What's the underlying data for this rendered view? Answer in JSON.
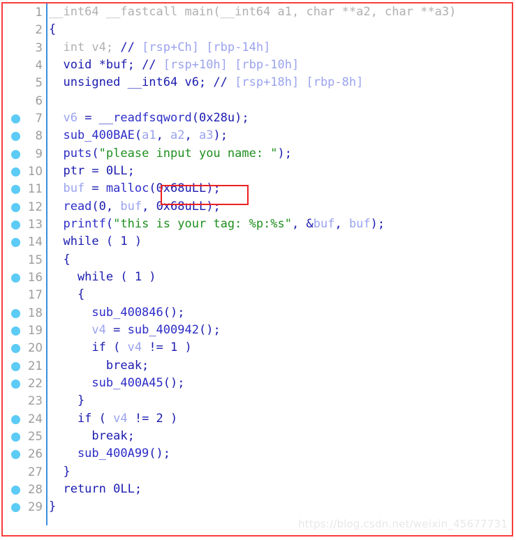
{
  "window": {
    "title": "Pseudocode-A",
    "border_color": "#fa3c3c",
    "background": "#ffffff"
  },
  "gutter": {
    "rule_color": "#3b8ede",
    "breakpoint_color": "#5ccbf5",
    "lineno_color": "#9c9c9c"
  },
  "annotation": {
    "name": "malloc-size-highlight",
    "color": "#ee2020",
    "covers_text": "(0x68uLL);"
  },
  "watermark": {
    "text": "https://blog.csdn.net/weixin_45677731",
    "color": "#e8e8e8"
  },
  "colors": {
    "dim": "#b0b0b0",
    "keyword": "#1b1bb0",
    "function": "#2d2dc8",
    "variable": "#9aa3ee",
    "string": "#1f8f1f",
    "comment": "#9aa3ee"
  },
  "code": {
    "language": "c-pseudocode",
    "plain_text": "__int64 __fastcall main(__int64 a1, char **a2, char **a3)\n{\n  int v4; // [rsp+Ch] [rbp-14h]\n  void *buf; // [rsp+10h] [rbp-10h]\n  unsigned __int64 v6; // [rsp+18h] [rbp-8h]\n\n  v6 = __readfsqword(0x28u);\n  sub_400BAE(a1, a2, a3);\n  puts(\"please input you name: \");\n  ptr = 0LL;\n  buf = malloc(0x68uLL);\n  read(0, buf, 0x68uLL);\n  printf(\"this is your tag: %p:%s\", &buf, buf);\n  while ( 1 )\n  {\n    while ( 1 )\n    {\n      sub_400846();\n      v4 = sub_400942();\n      if ( v4 != 1 )\n        break;\n      sub_400A45();\n    }\n    if ( v4 != 2 )\n      break;\n    sub_400A99();\n  }\n  return 0LL;\n}",
    "lines": [
      {
        "n": "1",
        "bp": false,
        "tokens": [
          {
            "c": "dim",
            "t": "__int64 __fastcall main(__int64 a1, char **a2, char **a3)"
          }
        ]
      },
      {
        "n": "2",
        "bp": false,
        "tokens": [
          {
            "c": "kw",
            "t": "{"
          }
        ]
      },
      {
        "n": "3",
        "bp": false,
        "tokens": [
          {
            "c": "dim",
            "t": "  int v4; "
          },
          {
            "c": "cmtmark",
            "t": "// "
          },
          {
            "c": "cmt",
            "t": "[rsp+Ch] [rbp-14h]"
          }
        ]
      },
      {
        "n": "4",
        "bp": false,
        "tokens": [
          {
            "c": "kw",
            "t": "  void *buf; "
          },
          {
            "c": "cmtmark",
            "t": "// "
          },
          {
            "c": "cmt",
            "t": "[rsp+10h] [rbp-10h]"
          }
        ]
      },
      {
        "n": "5",
        "bp": false,
        "tokens": [
          {
            "c": "kw",
            "t": "  unsigned __int64 v6; "
          },
          {
            "c": "cmtmark",
            "t": "// "
          },
          {
            "c": "cmt",
            "t": "[rsp+18h] [rbp-8h]"
          }
        ]
      },
      {
        "n": "6",
        "bp": false,
        "tokens": []
      },
      {
        "n": "7",
        "bp": true,
        "tokens": [
          {
            "c": "var",
            "t": "  v6 "
          },
          {
            "c": "kw",
            "t": "= "
          },
          {
            "c": "fn",
            "t": "__readfsqword"
          },
          {
            "c": "kw",
            "t": "(0x28u);"
          }
        ]
      },
      {
        "n": "8",
        "bp": true,
        "tokens": [
          {
            "c": "fn",
            "t": "  sub_400BAE"
          },
          {
            "c": "kw",
            "t": "("
          },
          {
            "c": "var",
            "t": "a1"
          },
          {
            "c": "kw",
            "t": ", "
          },
          {
            "c": "var",
            "t": "a2"
          },
          {
            "c": "kw",
            "t": ", "
          },
          {
            "c": "var",
            "t": "a3"
          },
          {
            "c": "kw",
            "t": ");"
          }
        ]
      },
      {
        "n": "9",
        "bp": true,
        "tokens": [
          {
            "c": "fn",
            "t": "  puts"
          },
          {
            "c": "kw",
            "t": "("
          },
          {
            "c": "str",
            "t": "\"please input you name: \""
          },
          {
            "c": "kw",
            "t": ");"
          }
        ]
      },
      {
        "n": "10",
        "bp": true,
        "tokens": [
          {
            "c": "kw",
            "t": "  ptr = 0LL;"
          }
        ]
      },
      {
        "n": "11",
        "bp": true,
        "tokens": [
          {
            "c": "var",
            "t": "  buf "
          },
          {
            "c": "kw",
            "t": "= "
          },
          {
            "c": "fn",
            "t": "malloc"
          },
          {
            "c": "kw",
            "t": "(0x68uLL);"
          }
        ]
      },
      {
        "n": "12",
        "bp": true,
        "tokens": [
          {
            "c": "fn",
            "t": "  read"
          },
          {
            "c": "kw",
            "t": "(0, "
          },
          {
            "c": "var",
            "t": "buf"
          },
          {
            "c": "kw",
            "t": ", 0x68uLL);"
          }
        ]
      },
      {
        "n": "13",
        "bp": true,
        "tokens": [
          {
            "c": "fn",
            "t": "  printf"
          },
          {
            "c": "kw",
            "t": "("
          },
          {
            "c": "str",
            "t": "\"this is your tag: %p:%s\""
          },
          {
            "c": "kw",
            "t": ", &"
          },
          {
            "c": "var",
            "t": "buf"
          },
          {
            "c": "kw",
            "t": ", "
          },
          {
            "c": "var",
            "t": "buf"
          },
          {
            "c": "kw",
            "t": ");"
          }
        ]
      },
      {
        "n": "14",
        "bp": true,
        "tokens": [
          {
            "c": "kw",
            "t": "  while ( 1 )"
          }
        ]
      },
      {
        "n": "15",
        "bp": false,
        "tokens": [
          {
            "c": "kw",
            "t": "  {"
          }
        ]
      },
      {
        "n": "16",
        "bp": true,
        "tokens": [
          {
            "c": "kw",
            "t": "    while ( 1 )"
          }
        ]
      },
      {
        "n": "17",
        "bp": false,
        "tokens": [
          {
            "c": "kw",
            "t": "    {"
          }
        ]
      },
      {
        "n": "18",
        "bp": true,
        "tokens": [
          {
            "c": "fn",
            "t": "      sub_400846"
          },
          {
            "c": "kw",
            "t": "();"
          }
        ]
      },
      {
        "n": "19",
        "bp": true,
        "tokens": [
          {
            "c": "var",
            "t": "      v4 "
          },
          {
            "c": "kw",
            "t": "= "
          },
          {
            "c": "fn",
            "t": "sub_400942"
          },
          {
            "c": "kw",
            "t": "();"
          }
        ]
      },
      {
        "n": "20",
        "bp": true,
        "tokens": [
          {
            "c": "kw",
            "t": "      if ( "
          },
          {
            "c": "var",
            "t": "v4"
          },
          {
            "c": "kw",
            "t": " != 1 )"
          }
        ]
      },
      {
        "n": "21",
        "bp": true,
        "tokens": [
          {
            "c": "kw",
            "t": "        break;"
          }
        ]
      },
      {
        "n": "22",
        "bp": true,
        "tokens": [
          {
            "c": "fn",
            "t": "      sub_400A45"
          },
          {
            "c": "kw",
            "t": "();"
          }
        ]
      },
      {
        "n": "23",
        "bp": false,
        "tokens": [
          {
            "c": "kw",
            "t": "    }"
          }
        ]
      },
      {
        "n": "24",
        "bp": true,
        "tokens": [
          {
            "c": "kw",
            "t": "    if ( "
          },
          {
            "c": "var",
            "t": "v4"
          },
          {
            "c": "kw",
            "t": " != 2 )"
          }
        ]
      },
      {
        "n": "25",
        "bp": true,
        "tokens": [
          {
            "c": "kw",
            "t": "      break;"
          }
        ]
      },
      {
        "n": "26",
        "bp": true,
        "tokens": [
          {
            "c": "fn",
            "t": "    sub_400A99"
          },
          {
            "c": "kw",
            "t": "();"
          }
        ]
      },
      {
        "n": "27",
        "bp": false,
        "tokens": [
          {
            "c": "kw",
            "t": "  }"
          }
        ]
      },
      {
        "n": "28",
        "bp": true,
        "tokens": [
          {
            "c": "kw",
            "t": "  return 0LL;"
          }
        ]
      },
      {
        "n": "29",
        "bp": true,
        "tokens": [
          {
            "c": "kw",
            "t": "}"
          }
        ]
      }
    ]
  }
}
